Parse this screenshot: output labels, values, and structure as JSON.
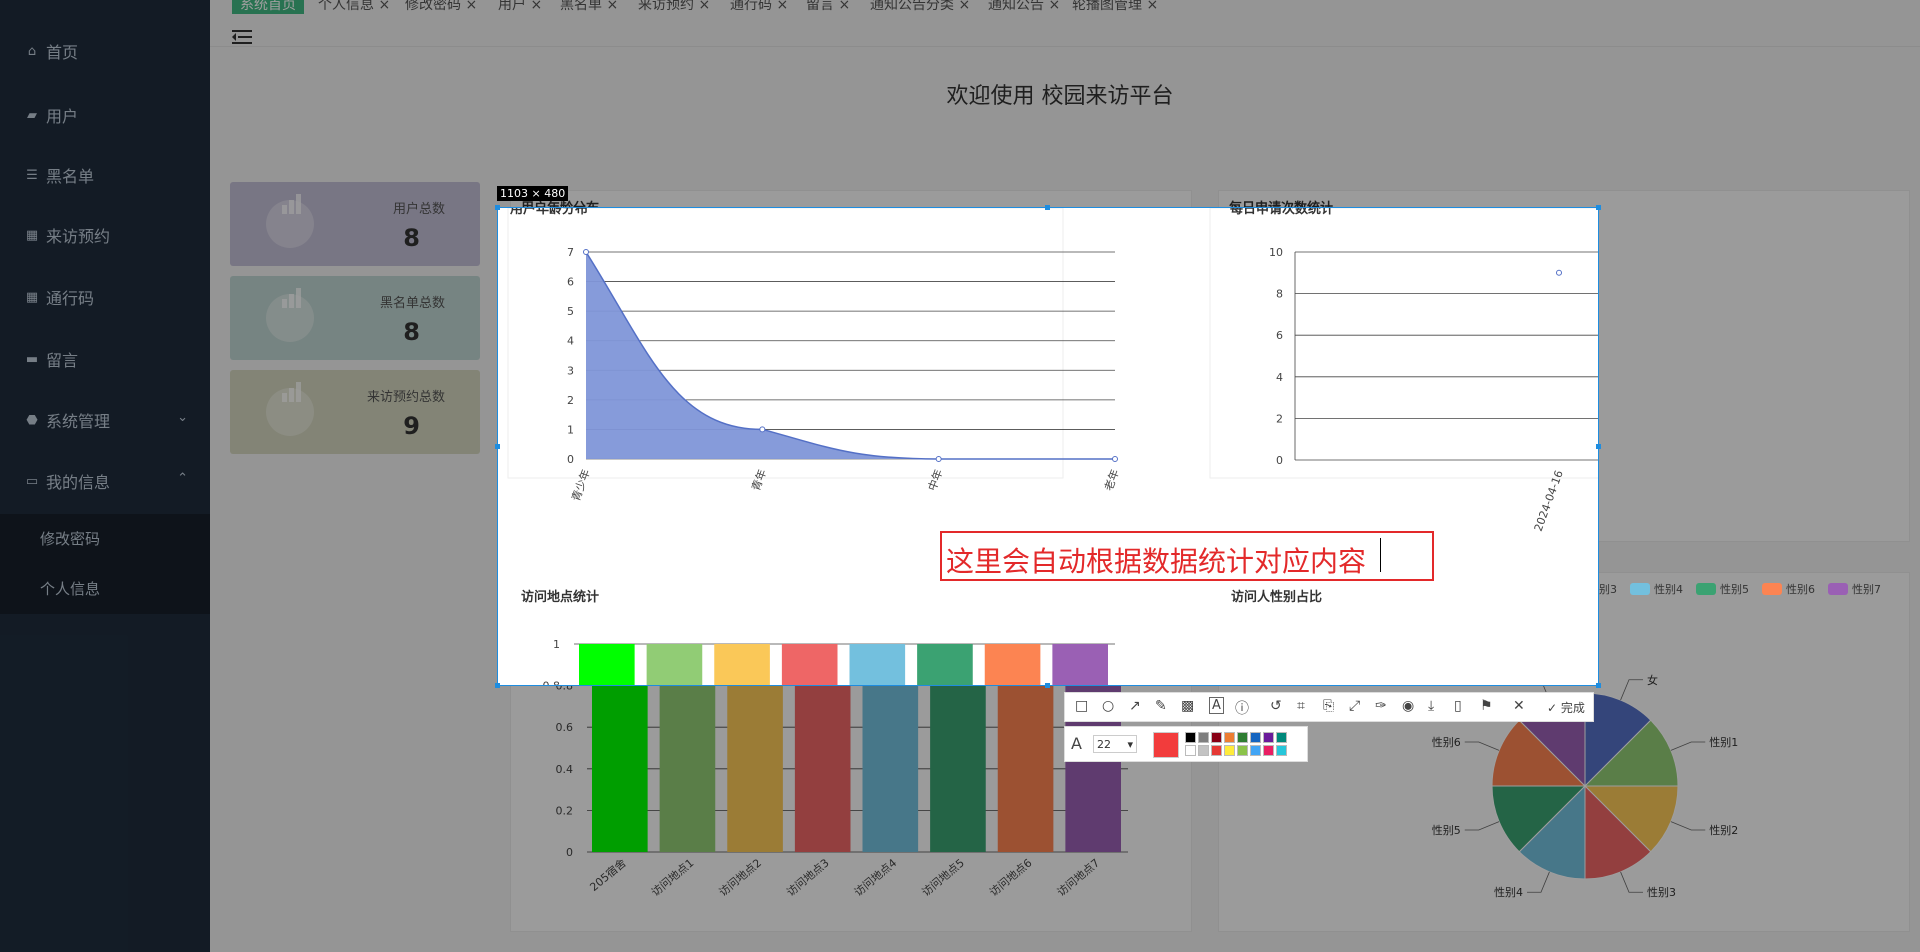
{
  "sidebar": {
    "items": [
      {
        "icon": "home-icon",
        "glyph": "⌂",
        "label": "首页"
      },
      {
        "icon": "user-icon",
        "glyph": "▰",
        "label": "用户"
      },
      {
        "icon": "list-icon",
        "glyph": "☰",
        "label": "黑名单"
      },
      {
        "icon": "grid-icon",
        "glyph": "▦",
        "label": "来访预约"
      },
      {
        "icon": "grid-icon",
        "glyph": "▦",
        "label": "通行码"
      },
      {
        "icon": "comment-icon",
        "glyph": "▬",
        "label": "留言"
      },
      {
        "icon": "gear-icon",
        "glyph": "⬣",
        "label": "系统管理"
      },
      {
        "icon": "profile-icon",
        "glyph": "▭",
        "label": "我的信息"
      }
    ],
    "submenu": [
      "修改密码",
      "个人信息"
    ]
  },
  "tabs": [
    "系统首页",
    "个人信息 ×",
    "修改密码 ×",
    "用户 ×",
    "黑名单 ×",
    "来访预约 ×",
    "通行码 ×",
    "留言 ×",
    "通知公告分类 ×",
    "通知公告 ×",
    "轮播图管理 ×"
  ],
  "welcome": "欢迎使用 校园来访平台",
  "stats": [
    {
      "label": "用户总数",
      "value": "8",
      "color": "#c2bed6"
    },
    {
      "label": "黑名单总数",
      "value": "8",
      "color": "#bfd6d2"
    },
    {
      "label": "来访预约总数",
      "value": "9",
      "color": "#d3d6be"
    }
  ],
  "charts": {
    "age_title": "用户年龄分布",
    "daily_title": "每日申请次数统计",
    "location_title": "访问地点统计",
    "gender_title": "访问人性别占比"
  },
  "chart_data": [
    {
      "type": "area",
      "title": "用户年龄分布",
      "categories": [
        "青少年",
        "青年",
        "中年",
        "老年"
      ],
      "values": [
        7,
        1,
        0,
        0
      ],
      "ylim": [
        0,
        7
      ],
      "yticks": [
        0,
        1,
        2,
        3,
        4,
        5,
        6,
        7
      ],
      "color": "#8096d8",
      "grid": true
    },
    {
      "type": "scatter",
      "title": "每日申请次数统计",
      "categories": [
        "2024-04-16"
      ],
      "values": [
        9
      ],
      "ylim": [
        0,
        10
      ],
      "yticks": [
        0,
        2,
        4,
        6,
        8,
        10
      ],
      "color": "#5470c6",
      "grid": true
    },
    {
      "type": "bar",
      "title": "访问地点统计",
      "categories": [
        "205宿舍",
        "访问地点1",
        "访问地点2",
        "访问地点3",
        "访问地点4",
        "访问地点5",
        "访问地点6",
        "访问地点7"
      ],
      "values": [
        1,
        1,
        1,
        1,
        1,
        1,
        1,
        1
      ],
      "colors": [
        "#00ff00",
        "#91cc75",
        "#fac858",
        "#ee6666",
        "#73c0de",
        "#3ba272",
        "#fc8452",
        "#9a60b4"
      ],
      "ylim": [
        0,
        1
      ],
      "yticks": [
        0,
        0.2,
        0.4,
        0.6,
        0.8,
        1
      ],
      "grid": true
    },
    {
      "type": "pie",
      "title": "访问人性别占比",
      "labels": [
        "女",
        "性别1",
        "性别2",
        "性别3",
        "性别4",
        "性别5",
        "性别6",
        "性别7"
      ],
      "values": [
        1,
        1,
        1,
        1,
        1,
        1,
        1,
        1
      ],
      "colors": [
        "#5470c6",
        "#91cc75",
        "#fac858",
        "#ee6666",
        "#73c0de",
        "#3ba272",
        "#fc8452",
        "#9a60b4"
      ],
      "legend": "top"
    }
  ],
  "screenshot_tool": {
    "size_label": "1103 × 480",
    "annotation_text": "这里会自动根据数据统计对应内容",
    "done_label": "完成",
    "font_size": "22",
    "current_color": "#f23c3c",
    "palette": [
      "#000000",
      "#7f7f7f",
      "#880015",
      "#ed7d31",
      "#2e7d32",
      "#1565c0",
      "#6a1b9a",
      "#00897b",
      "#ffffff",
      "#c3c3c3",
      "#e53935",
      "#ffeb3b",
      "#8bc34a",
      "#42a5f5",
      "#e91e63",
      "#26c6da"
    ],
    "tools": [
      "rectangle-tool-icon",
      "ellipse-tool-icon",
      "arrow-tool-icon",
      "pen-tool-icon",
      "mosaic-tool-icon",
      "text-tool-icon",
      "number-tool-icon",
      "undo-icon",
      "ocr-icon",
      "copy-icon",
      "scroll-capture-icon",
      "pin-icon",
      "record-icon",
      "save-icon",
      "phone-icon",
      "bookmark-icon",
      "cancel-icon"
    ]
  }
}
